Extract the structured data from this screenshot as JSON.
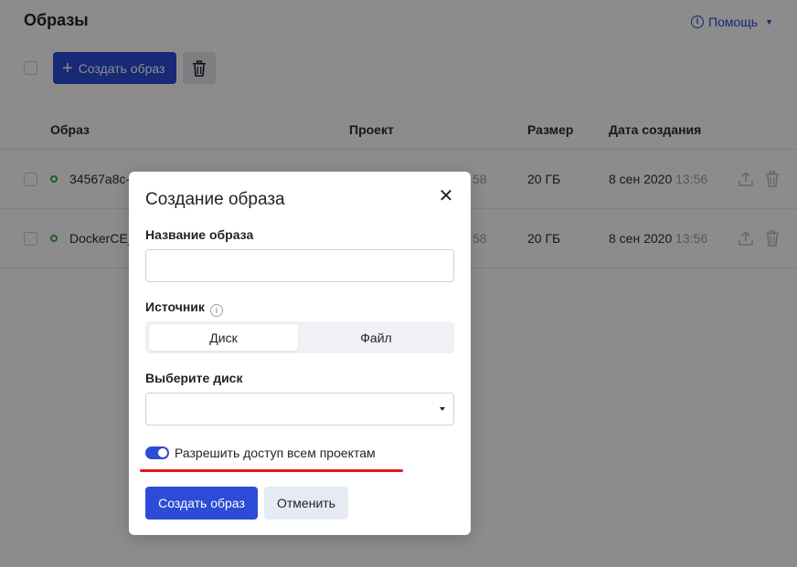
{
  "page": {
    "title": "Образы",
    "help_label": "Помощь",
    "help_icon": "info-icon",
    "accent_color": "#2c4bd6"
  },
  "toolbar": {
    "create_label": "Создать образ",
    "create_icon": "plus-icon",
    "delete_icon": "trash-icon"
  },
  "table": {
    "columns": [
      "Образ",
      "Проект",
      "Размер",
      "Дата создания"
    ],
    "rows": [
      {
        "name": "34567a8c-",
        "project_fragment": "58",
        "size": "20 ГБ",
        "date": "8 сен 2020",
        "time": "13:56",
        "status_color": "#2eb04f"
      },
      {
        "name": "DockerCE_",
        "project_fragment": "58",
        "size": "20 ГБ",
        "date": "8 сен 2020",
        "time": "13:56",
        "status_color": "#2eb04f"
      }
    ]
  },
  "modal": {
    "title": "Создание образа",
    "name_label": "Название образа",
    "name_value": "",
    "source_label": "Источник",
    "source_options": [
      "Диск",
      "Файл"
    ],
    "source_selected": "Диск",
    "disk_label": "Выберите диск",
    "disk_value": "",
    "toggle_label": "Разрешить доступ всем проектам",
    "toggle_on": true,
    "submit_label": "Создать образ",
    "cancel_label": "Отменить",
    "highlight_color": "#e5161d"
  }
}
